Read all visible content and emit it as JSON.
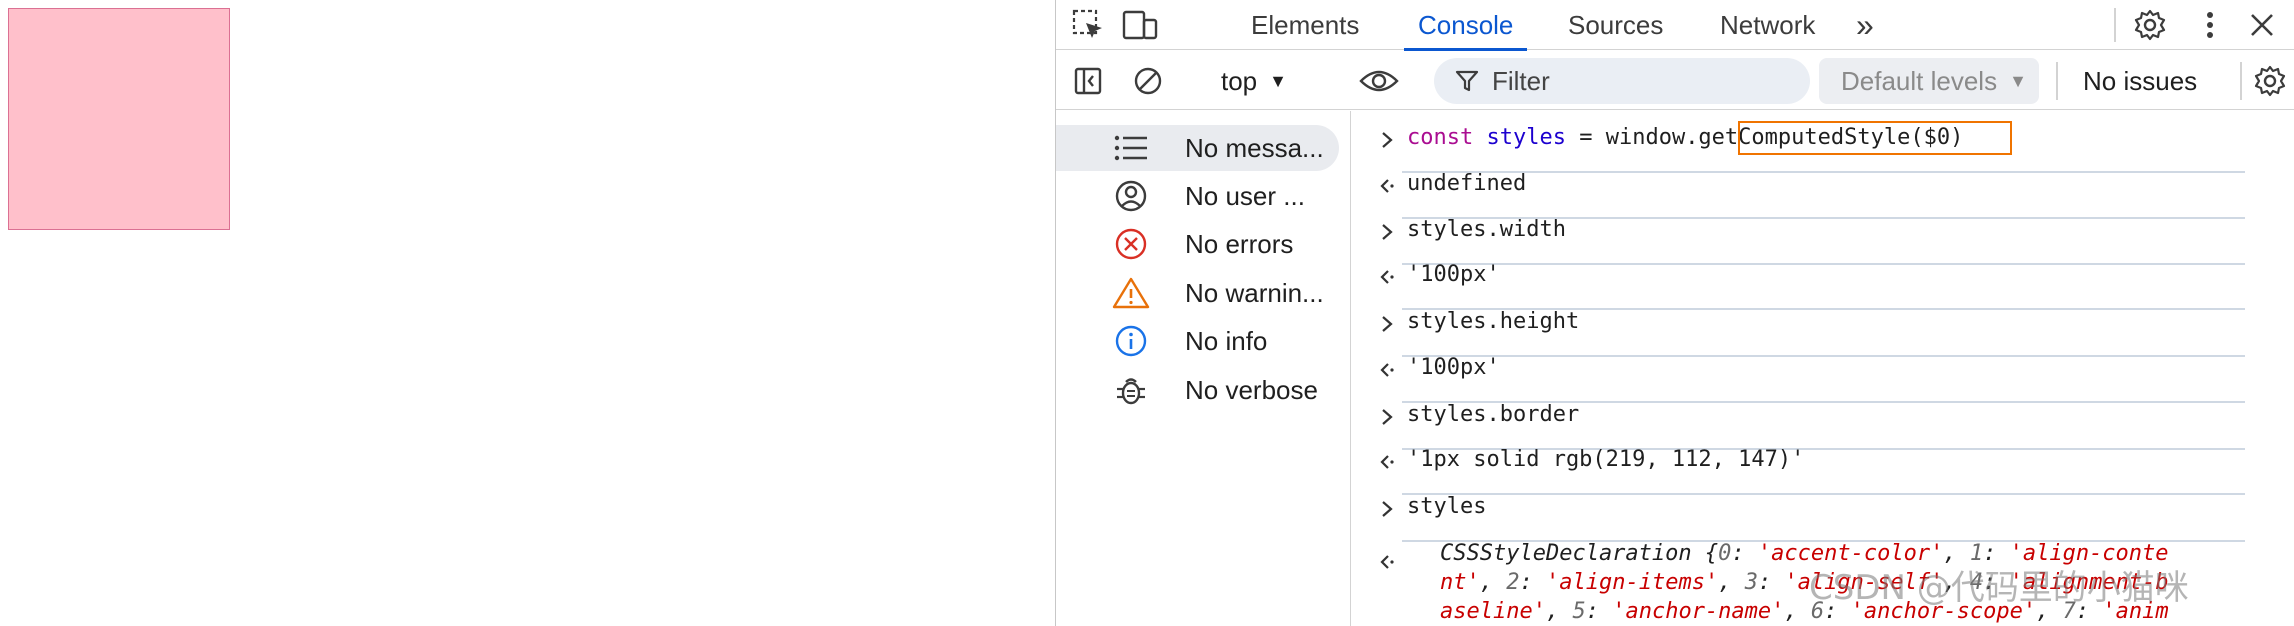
{
  "page": {
    "box_name": "pink-box"
  },
  "devtools": {
    "tabs": [
      {
        "label": "Elements",
        "active": false
      },
      {
        "label": "Console",
        "active": true
      },
      {
        "label": "Sources",
        "active": false
      },
      {
        "label": "Network",
        "active": false
      }
    ],
    "more_tabs": "»",
    "icons": [
      "inspect-element-icon",
      "device-toolbar-icon",
      "more-tabs-icon",
      "settings-icon",
      "kebab-menu-icon",
      "close-icon"
    ],
    "toolbar": {
      "context": "top",
      "filter_placeholder": "Filter",
      "levels": "Default levels",
      "issues": "No issues"
    },
    "sidebar": [
      {
        "label": "No messa...",
        "icon": "list-icon",
        "selected": true
      },
      {
        "label": "No user ...",
        "icon": "user-icon",
        "selected": false
      },
      {
        "label": "No errors",
        "icon": "error-icon",
        "selected": false
      },
      {
        "label": "No warnin...",
        "icon": "warning-icon",
        "selected": false
      },
      {
        "label": "No info",
        "icon": "info-icon",
        "selected": false
      },
      {
        "label": "No verbose",
        "icon": "bug-icon",
        "selected": false
      }
    ],
    "console": {
      "input1_kw": "const",
      "input1_var": "styles",
      "input1_eq": "=",
      "input1_call": "window.getComputedStyle($0)",
      "output1": "undefined",
      "input2": "styles.width",
      "output2": "'100px'",
      "input3": "styles.height",
      "output3": "'100px'",
      "input4": "styles.border",
      "output4": "'1px solid rgb(219, 112, 147)'",
      "input5": "styles",
      "output5_line1_head": "CSSStyleDeclaration {",
      "output5_k0": "0",
      "output5_v0": "'accent-color'",
      "output5_k1": "1",
      "output5_v1a": "'align-conte",
      "output5_v1b": "nt'",
      "output5_k2": "2",
      "output5_v2": "'align-items'",
      "output5_k3": "3",
      "output5_v3": "'align-self'",
      "output5_k4": "4",
      "output5_v4a": "'alignment-b",
      "output5_v4b": "aseline'",
      "output5_k5": "5",
      "output5_v5": "'anchor-name'",
      "output5_k6": "6",
      "output5_v6": "'anchor-scope'",
      "output5_k7": "7",
      "output5_v7": "'anim"
    },
    "watermark": "CSDN @代码里的小猫咪"
  },
  "colors": {
    "accent": "#0b57d0",
    "highlight": "#f07400",
    "pink_fill": "#ffc0cb",
    "pink_border": "#db7093",
    "error": "#d93025",
    "warning": "#e8710a"
  }
}
